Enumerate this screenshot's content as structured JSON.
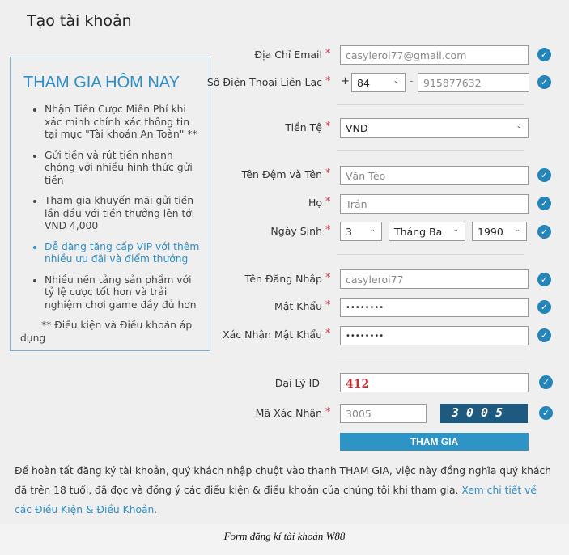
{
  "title": "Tạo tài khoản",
  "promo": {
    "heading": "THAM GIA HÔM NAY",
    "items": [
      "Nhận Tiền Cược Miễn Phí khi xác minh chính xác thông tin tại mục \"Tài khoản An Toàn\" **",
      "Gửi tiền và rút tiền nhanh chóng với nhiều hình thức gửi tiền",
      "Tham gia khuyến mãi gửi tiền lần đầu với tiền thưởng lên tới VND 4,000",
      "Dễ dàng tăng cấp VIP với thêm nhiều ưu đãi và điểm thưởng",
      "Nhiều nền tảng sản phẩm với tỷ lệ cược tốt hơn và trải nghiệm chơi game đầy đủ hơn"
    ],
    "note": "** Điều kiện và Điều khoản áp dụng"
  },
  "form": {
    "required_mark": "*",
    "email": {
      "label": "Địa Chỉ Email",
      "value": "casyleroi77@gmail.com"
    },
    "phone": {
      "label": "Số Điện Thoại Liên Lạc",
      "plus": "+",
      "code": "84",
      "dash": "-",
      "value": "915877632"
    },
    "currency": {
      "label": "Tiền Tệ",
      "value": "VND"
    },
    "first_name": {
      "label": "Tên Đệm và Tên",
      "value": "Văn Tèo"
    },
    "last_name": {
      "label": "Họ",
      "value": "Trần"
    },
    "dob": {
      "label": "Ngày Sinh",
      "day": "3",
      "month": "Tháng Ba",
      "year": "1990"
    },
    "username": {
      "label": "Tên Đăng Nhập",
      "value": "casyleroi77"
    },
    "password": {
      "label": "Mật Khẩu",
      "value": "••••••••"
    },
    "confirm": {
      "label": "Xác Nhận Mật Khẩu",
      "value": "••••••••"
    },
    "agent": {
      "label": "Đại Lý ID",
      "value": "412"
    },
    "captcha": {
      "label": "Mã Xác Nhận",
      "value": "3005",
      "image_text": "3005"
    },
    "submit": "THAM GIA"
  },
  "footer": {
    "text": "Để hoàn tất đăng ký tài khoản, quý khách nhập chuột vào thanh THAM GIA, việc này đồng nghĩa quý khách đã trên 18 tuổi, đã đọc và đồng ý các điều kiện & điều khoản của chúng tôi khi tham gia. ",
    "link": "Xem chi tiết về các Điều Kiện & Điều Khoản."
  },
  "caption": "Form đăng kí tài khoản W88",
  "colors": {
    "accent": "#2e94c6",
    "check": "#2584b8",
    "required": "#d4374a",
    "captcha_bg": "#1e5a80"
  }
}
